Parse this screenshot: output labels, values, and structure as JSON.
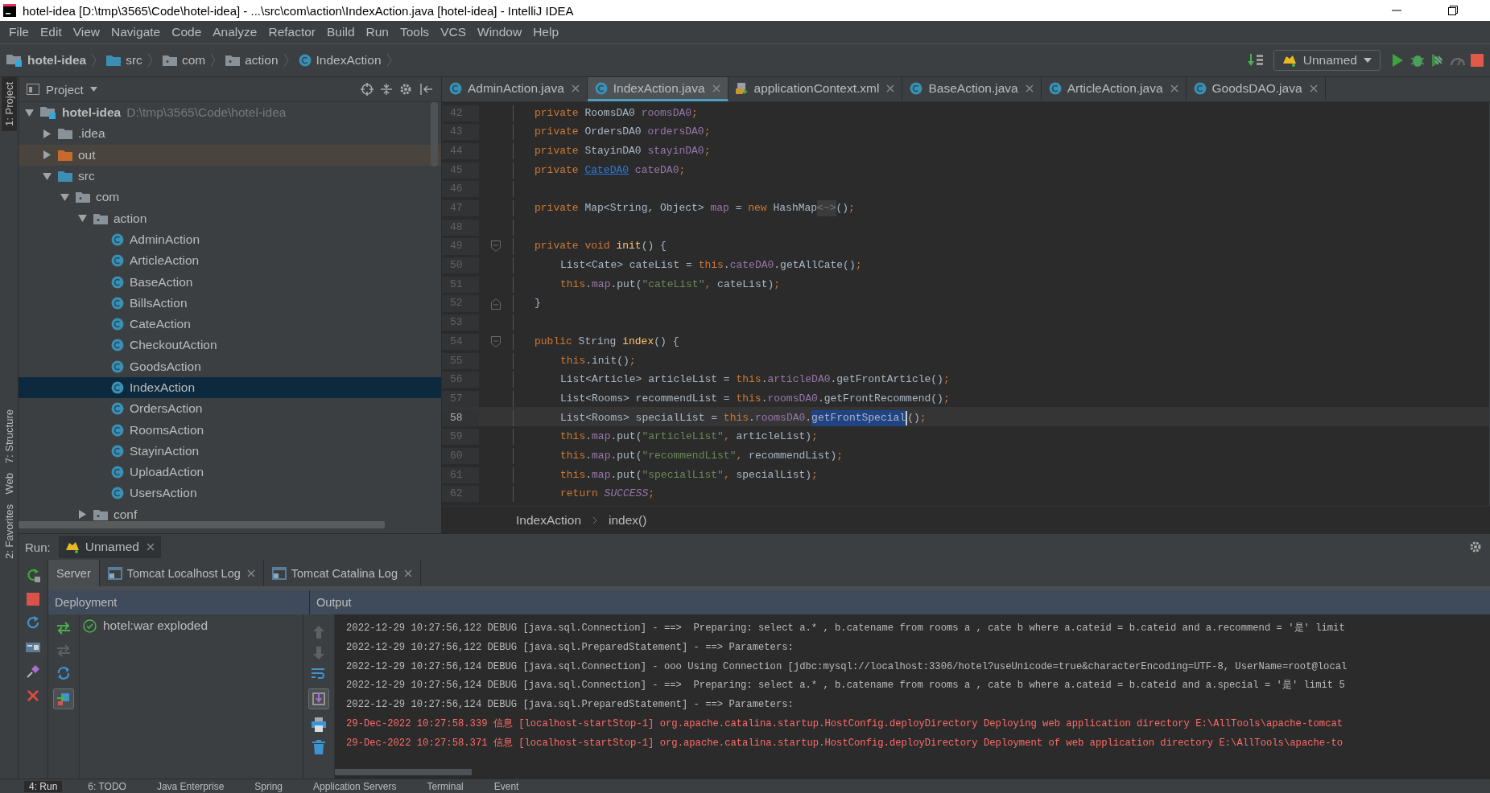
{
  "window": {
    "title": "hotel-idea [D:\\tmp\\3565\\Code\\hotel-idea] - ...\\src\\com\\action\\IndexAction.java [hotel-idea] - IntelliJ IDEA"
  },
  "menu": [
    "File",
    "Edit",
    "View",
    "Navigate",
    "Code",
    "Analyze",
    "Refactor",
    "Build",
    "Run",
    "Tools",
    "VCS",
    "Window",
    "Help"
  ],
  "navigation_bar": [
    {
      "label": "hotel-idea",
      "kind": "module"
    },
    {
      "label": "src",
      "kind": "source-folder"
    },
    {
      "label": "com",
      "kind": "package"
    },
    {
      "label": "action",
      "kind": "package"
    },
    {
      "label": "IndexAction",
      "kind": "class"
    }
  ],
  "run_configuration": {
    "label": "Unnamed"
  },
  "side_stripe": [
    {
      "label": "1: Project",
      "selected": true
    },
    {
      "label": "7: Structure",
      "selected": false
    },
    {
      "label": "Web",
      "selected": false
    },
    {
      "label": "2: Favorites",
      "selected": false
    }
  ],
  "project": {
    "title": "Project",
    "tree": {
      "label": "hotel-idea",
      "path": "D:\\tmp\\3565\\Code\\hotel-idea",
      "kind": "module",
      "expanded": true,
      "selected": false,
      "children": [
        {
          "label": ".idea",
          "kind": "folder",
          "expanded": false,
          "selected": false
        },
        {
          "label": "out",
          "kind": "excluded-folder",
          "expanded": false,
          "selected": false
        },
        {
          "label": "src",
          "kind": "source-folder",
          "expanded": true,
          "selected": false,
          "children": [
            {
              "label": "com",
              "kind": "package",
              "expanded": true,
              "selected": false,
              "children": [
                {
                  "label": "action",
                  "kind": "package",
                  "expanded": true,
                  "selected": false,
                  "children": [
                    {
                      "label": "AdminAction",
                      "kind": "class",
                      "selected": false
                    },
                    {
                      "label": "ArticleAction",
                      "kind": "class",
                      "selected": false
                    },
                    {
                      "label": "BaseAction",
                      "kind": "class",
                      "selected": false
                    },
                    {
                      "label": "BillsAction",
                      "kind": "class",
                      "selected": false
                    },
                    {
                      "label": "CateAction",
                      "kind": "class",
                      "selected": false
                    },
                    {
                      "label": "CheckoutAction",
                      "kind": "class",
                      "selected": false
                    },
                    {
                      "label": "GoodsAction",
                      "kind": "class",
                      "selected": false
                    },
                    {
                      "label": "IndexAction",
                      "kind": "class",
                      "selected": true
                    },
                    {
                      "label": "OrdersAction",
                      "kind": "class",
                      "selected": false
                    },
                    {
                      "label": "RoomsAction",
                      "kind": "class",
                      "selected": false
                    },
                    {
                      "label": "StayinAction",
                      "kind": "class",
                      "selected": false
                    },
                    {
                      "label": "UploadAction",
                      "kind": "class",
                      "selected": false
                    },
                    {
                      "label": "UsersAction",
                      "kind": "class",
                      "selected": false
                    }
                  ]
                },
                {
                  "label": "conf",
                  "kind": "package",
                  "expanded": false,
                  "selected": false
                }
              ]
            }
          ]
        }
      ]
    }
  },
  "editor_tabs": [
    {
      "label": "AdminAction.java",
      "kind": "class",
      "selected": false
    },
    {
      "label": "IndexAction.java",
      "kind": "class",
      "selected": true
    },
    {
      "label": "applicationContext.xml",
      "kind": "xml",
      "selected": false
    },
    {
      "label": "BaseAction.java",
      "kind": "class",
      "selected": false
    },
    {
      "label": "ArticleAction.java",
      "kind": "class",
      "selected": false
    },
    {
      "label": "GoodsDAO.java",
      "kind": "class",
      "selected": false
    }
  ],
  "code_lines": [
    {
      "number": "42",
      "kind": "member",
      "current": false,
      "tokens": [
        {
          "kind": "kw",
          "text": "private "
        },
        {
          "kind": "plain",
          "text": "RoomsDA0 "
        },
        {
          "kind": "field",
          "text": "roomsDA0"
        },
        {
          "kind": "kw",
          "text": ";"
        }
      ]
    },
    {
      "number": "43",
      "kind": "member",
      "current": false,
      "tokens": [
        {
          "kind": "kw",
          "text": "private "
        },
        {
          "kind": "plain",
          "text": "OrdersDA0 "
        },
        {
          "kind": "field",
          "text": "ordersDA0"
        },
        {
          "kind": "kw",
          "text": ";"
        }
      ]
    },
    {
      "number": "44",
      "kind": "member",
      "current": false,
      "tokens": [
        {
          "kind": "kw",
          "text": "private "
        },
        {
          "kind": "plain",
          "text": "StayinDA0 "
        },
        {
          "kind": "field",
          "text": "stayinDA0"
        },
        {
          "kind": "kw",
          "text": ";"
        }
      ]
    },
    {
      "number": "45",
      "kind": "member",
      "current": false,
      "tokens": [
        {
          "kind": "kw",
          "text": "private "
        },
        {
          "kind": "link",
          "text": "CateDA0"
        },
        {
          "kind": "field",
          "text": " cateDA0"
        },
        {
          "kind": "kw",
          "text": ";"
        }
      ]
    },
    {
      "number": "46",
      "kind": "blank",
      "current": false
    },
    {
      "number": "47",
      "kind": "member",
      "current": false,
      "tokens": [
        {
          "kind": "kw",
          "text": "private "
        },
        {
          "kind": "plain",
          "text": "Map<String, Object> "
        },
        {
          "kind": "field",
          "text": "map"
        },
        {
          "kind": "plain",
          "text": " = "
        },
        {
          "kind": "kw",
          "text": "new "
        },
        {
          "kind": "plain",
          "text": "HashMap"
        },
        {
          "kind": "hint",
          "text": "<~>"
        },
        {
          "kind": "plain",
          "text": "()"
        },
        {
          "kind": "kw",
          "text": ";"
        }
      ]
    },
    {
      "number": "48",
      "kind": "blank",
      "current": false
    },
    {
      "number": "49",
      "kind": "fold-open",
      "current": false,
      "tokens": [
        {
          "kind": "kw",
          "text": "private void "
        },
        {
          "kind": "method",
          "text": "init"
        },
        {
          "kind": "plain",
          "text": "() {"
        }
      ]
    },
    {
      "number": "50",
      "kind": "body",
      "current": false,
      "tokens": [
        {
          "kind": "plain",
          "text": "List<Cate> cateList = "
        },
        {
          "kind": "kw",
          "text": "this"
        },
        {
          "kind": "plain",
          "text": "."
        },
        {
          "kind": "field",
          "text": "cateDA0"
        },
        {
          "kind": "plain",
          "text": ".getAllCate()"
        },
        {
          "kind": "kw",
          "text": ";"
        }
      ]
    },
    {
      "number": "51",
      "kind": "body",
      "current": false,
      "tokens": [
        {
          "kind": "kw",
          "text": "this"
        },
        {
          "kind": "plain",
          "text": "."
        },
        {
          "kind": "field",
          "text": "map"
        },
        {
          "kind": "plain",
          "text": ".put("
        },
        {
          "kind": "str",
          "text": "\"cateList\""
        },
        {
          "kind": "kw",
          "text": ", "
        },
        {
          "kind": "plain",
          "text": "cateList)"
        },
        {
          "kind": "kw",
          "text": ";"
        }
      ]
    },
    {
      "number": "52",
      "kind": "fold-close",
      "current": false,
      "tokens": [
        {
          "kind": "plain",
          "text": "}"
        }
      ]
    },
    {
      "number": "53",
      "kind": "blank",
      "current": false
    },
    {
      "number": "54",
      "kind": "fold-open",
      "current": false,
      "tokens": [
        {
          "kind": "kw",
          "text": "public "
        },
        {
          "kind": "plain",
          "text": "String "
        },
        {
          "kind": "method",
          "text": "index"
        },
        {
          "kind": "plain",
          "text": "() {"
        }
      ]
    },
    {
      "number": "55",
      "kind": "body",
      "current": false,
      "tokens": [
        {
          "kind": "kw",
          "text": "this"
        },
        {
          "kind": "plain",
          "text": ".init()"
        },
        {
          "kind": "kw",
          "text": ";"
        }
      ]
    },
    {
      "number": "56",
      "kind": "body",
      "current": false,
      "tokens": [
        {
          "kind": "plain",
          "text": "List<Article> articleList = "
        },
        {
          "kind": "kw",
          "text": "this"
        },
        {
          "kind": "plain",
          "text": "."
        },
        {
          "kind": "field",
          "text": "articleDA0"
        },
        {
          "kind": "plain",
          "text": ".getFrontArticle()"
        },
        {
          "kind": "kw",
          "text": ";"
        }
      ]
    },
    {
      "number": "57",
      "kind": "body",
      "current": false,
      "tokens": [
        {
          "kind": "plain",
          "text": "List<Rooms> recommendList = "
        },
        {
          "kind": "kw",
          "text": "this"
        },
        {
          "kind": "plain",
          "text": "."
        },
        {
          "kind": "field",
          "text": "roomsDA0"
        },
        {
          "kind": "plain",
          "text": ".getFrontRecommend()"
        },
        {
          "kind": "kw",
          "text": ";"
        }
      ]
    },
    {
      "number": "58",
      "kind": "body",
      "current": true,
      "tokens": [
        {
          "kind": "plain",
          "text": "List<Rooms> specialList = "
        },
        {
          "kind": "kw",
          "text": "this"
        },
        {
          "kind": "plain",
          "text": "."
        },
        {
          "kind": "field",
          "text": "roomsDA0"
        },
        {
          "kind": "plain",
          "text": "."
        },
        {
          "kind": "sel",
          "text": "getFrontSpecial"
        },
        {
          "kind": "plain",
          "text": "()"
        },
        {
          "kind": "kw",
          "text": ";"
        }
      ]
    },
    {
      "number": "59",
      "kind": "body",
      "current": false,
      "tokens": [
        {
          "kind": "kw",
          "text": "this"
        },
        {
          "kind": "plain",
          "text": "."
        },
        {
          "kind": "field",
          "text": "map"
        },
        {
          "kind": "plain",
          "text": ".put("
        },
        {
          "kind": "str",
          "text": "\"articleList\""
        },
        {
          "kind": "kw",
          "text": ", "
        },
        {
          "kind": "plain",
          "text": "articleList)"
        },
        {
          "kind": "kw",
          "text": ";"
        }
      ]
    },
    {
      "number": "60",
      "kind": "body",
      "current": false,
      "tokens": [
        {
          "kind": "kw",
          "text": "this"
        },
        {
          "kind": "plain",
          "text": "."
        },
        {
          "kind": "field",
          "text": "map"
        },
        {
          "kind": "plain",
          "text": ".put("
        },
        {
          "kind": "str",
          "text": "\"recommendList\""
        },
        {
          "kind": "kw",
          "text": ", "
        },
        {
          "kind": "plain",
          "text": "recommendList)"
        },
        {
          "kind": "kw",
          "text": ";"
        }
      ]
    },
    {
      "number": "61",
      "kind": "body",
      "current": false,
      "tokens": [
        {
          "kind": "kw",
          "text": "this"
        },
        {
          "kind": "plain",
          "text": "."
        },
        {
          "kind": "field",
          "text": "map"
        },
        {
          "kind": "plain",
          "text": ".put("
        },
        {
          "kind": "str",
          "text": "\"specialList\""
        },
        {
          "kind": "kw",
          "text": ", "
        },
        {
          "kind": "plain",
          "text": "specialList)"
        },
        {
          "kind": "kw",
          "text": ";"
        }
      ]
    },
    {
      "number": "62",
      "kind": "body",
      "current": false,
      "tokens": [
        {
          "kind": "kw",
          "text": "return "
        },
        {
          "kind": "const",
          "text": "SUCCESS"
        },
        {
          "kind": "kw",
          "text": ";"
        }
      ]
    }
  ],
  "editor_breadcrumb": [
    "IndexAction",
    "index()"
  ],
  "run_panel": {
    "label": "Run:",
    "tabs": [
      {
        "label": "Unnamed",
        "selected": true
      }
    ],
    "server_tabs": [
      {
        "label": "Server",
        "kind": "server",
        "selected": true
      },
      {
        "label": "Tomcat Localhost Log",
        "kind": "log",
        "selected": false
      },
      {
        "label": "Tomcat Catalina Log",
        "kind": "log",
        "selected": false
      }
    ],
    "deployment_header": "Deployment",
    "output_header": "Output",
    "deployments": [
      {
        "label": "hotel:war exploded",
        "kind": "deployed"
      }
    ],
    "output": [
      {
        "kind": "debug",
        "text": "2022-12-29 10:27:56,122 DEBUG [java.sql.Connection] - ==>  Preparing: select a.* , b.catename from rooms a , cate b where a.cateid = b.cateid and a.recommend = '是' limit"
      },
      {
        "kind": "debug",
        "text": "2022-12-29 10:27:56,122 DEBUG [java.sql.PreparedStatement] - ==> Parameters:"
      },
      {
        "kind": "debug",
        "text": "2022-12-29 10:27:56,124 DEBUG [java.sql.Connection] - ooo Using Connection [jdbc:mysql://localhost:3306/hotel?useUnicode=true&characterEncoding=UTF-8, UserName=root@local"
      },
      {
        "kind": "debug",
        "text": "2022-12-29 10:27:56,124 DEBUG [java.sql.Connection] - ==>  Preparing: select a.* , b.catename from rooms a , cate b where a.cateid = b.cateid and a.special = '是' limit 5"
      },
      {
        "kind": "debug",
        "text": "2022-12-29 10:27:56,124 DEBUG [java.sql.PreparedStatement] - ==> Parameters:"
      },
      {
        "kind": "info",
        "text": "29-Dec-2022 10:27:58.339 信息 [localhost-startStop-1] org.apache.catalina.startup.HostConfig.deployDirectory Deploying web application directory E:\\AllTools\\apache-tomcat"
      },
      {
        "kind": "info",
        "text": "29-Dec-2022 10:27:58.371 信息 [localhost-startStop-1] org.apache.catalina.startup.HostConfig.deployDirectory Deployment of web application directory E:\\AllTools\\apache-to"
      }
    ]
  },
  "tool_windows": [
    {
      "label": "4: Run",
      "selected": true
    },
    {
      "label": "6: TODO",
      "selected": false
    },
    {
      "label": "Java Enterprise",
      "selected": false
    },
    {
      "label": "Spring",
      "selected": false
    },
    {
      "label": "Application Servers",
      "selected": false
    },
    {
      "label": "Terminal",
      "selected": false
    },
    {
      "label": "Event",
      "selected": false
    }
  ]
}
